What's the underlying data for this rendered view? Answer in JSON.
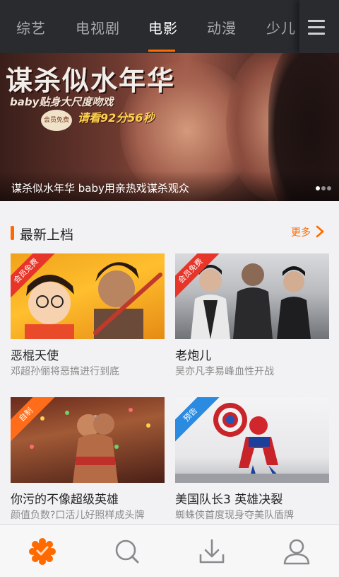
{
  "top_tabs": [
    {
      "label": "综艺",
      "active": false
    },
    {
      "label": "电视剧",
      "active": false
    },
    {
      "label": "电影",
      "active": true
    },
    {
      "label": "动漫",
      "active": false
    },
    {
      "label": "少儿",
      "active": false
    }
  ],
  "menu_icon": "hamburger-menu-icon",
  "hero": {
    "poster_title": "谋杀似水年华",
    "poster_line1": "baby贴身大尺度吻戏",
    "poster_line2": "请看92分56秒",
    "poster_stamp": "会员免费",
    "caption": "谋杀似水年华 baby用亲热戏谋杀观众",
    "page_count": 3,
    "active_page": 1
  },
  "section": {
    "title": "最新上档",
    "more_label": "更多"
  },
  "cards": [
    {
      "title": "恶棍天使",
      "desc": "邓超孙俪将恶搞进行到底",
      "badge": "会员免费",
      "badge_color": "#e8352a"
    },
    {
      "title": "老炮儿",
      "desc": "吴亦凡李易峰血性开战",
      "badge": "会员免费",
      "badge_color": "#e8352a"
    },
    {
      "title": "你污的不像超级英雄",
      "desc": "颜值负数?口活儿好照样成头牌",
      "badge": "自制",
      "badge_color": "#ff6d1a"
    },
    {
      "title": "美国队长3 英雄决裂",
      "desc": "蜘蛛侠首度现身夺美队盾牌",
      "badge": "预告",
      "badge_color": "#2a8be0"
    }
  ],
  "bottom_nav": [
    {
      "name": "home",
      "icon": "home-flower-icon",
      "active": true
    },
    {
      "name": "search",
      "icon": "search-icon",
      "active": false
    },
    {
      "name": "download",
      "icon": "download-icon",
      "active": false
    },
    {
      "name": "profile",
      "icon": "user-icon",
      "active": false
    }
  ],
  "colors": {
    "accent": "#ff6a00",
    "topbar": "#2a2b2f",
    "tab_inactive": "#a9aaae",
    "tab_active": "#ffffff",
    "nav_icon": "#8a8a8e"
  }
}
